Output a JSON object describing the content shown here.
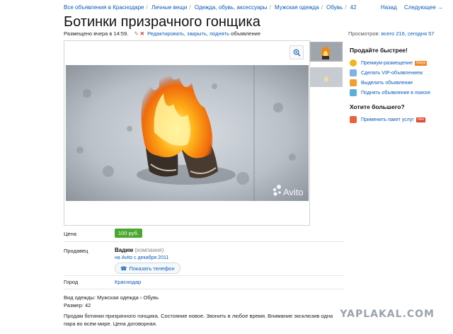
{
  "breadcrumbs": [
    {
      "label": "Все объявления в Краснодаре"
    },
    {
      "label": "Личные вещи"
    },
    {
      "label": "Одежда, обувь, аксессуары"
    },
    {
      "label": "Мужская одежда"
    },
    {
      "label": "Обувь"
    },
    {
      "label": "42"
    }
  ],
  "topnav": {
    "back": "Назад",
    "next": "Следующее →"
  },
  "title": "Ботинки призрачного гонщика",
  "meta": {
    "posted": "Размещено вчера в 14:59.",
    "edit_links": "Редактировать, закрыть, поднять",
    "tail": "объявление"
  },
  "views": {
    "label": "Просмотров:",
    "value": "всего 216, сегодня 57"
  },
  "photo": {
    "watermark": "Avito"
  },
  "sidebar": {
    "promote_title": "Продайте быстрее!",
    "promote_items": [
      {
        "label": "Премиум-размещение",
        "badge": "бонус",
        "icon": "star-coin-icon",
        "color": "#f2b51a"
      },
      {
        "label": "Сделать VIP-объявлением",
        "badge": "",
        "icon": "vip-icon",
        "color": "#7fb3e6"
      },
      {
        "label": "Выделить объявление",
        "badge": "",
        "icon": "highlight-icon",
        "color": "#f0a030"
      },
      {
        "label": "Поднять объявление в поиске",
        "badge": "",
        "icon": "raise-icon",
        "color": "#5ab0d8"
      }
    ],
    "more_title": "Хотите большего?",
    "more_items": [
      {
        "label": "Применить пакет услуг",
        "badge": "new",
        "icon": "package-icon",
        "color": "#e8643c"
      }
    ]
  },
  "price": {
    "label": "Цена",
    "value": "100 руб."
  },
  "seller": {
    "label": "Продавец",
    "name": "Вадим",
    "role": "(компания)",
    "since": "на Avito с декабря 2011",
    "phone_button": "Показать телефон"
  },
  "city": {
    "label": "Город",
    "value": "Краснодар"
  },
  "params": {
    "type": "Вид одежды: Мужская одежда › Обувь",
    "size": "Размер: 42"
  },
  "description": "Продам ботинки призрачного гонщика. Состояние новое. Звонить в любое время. Внимание эксклюзив одна пара во всем мире. Цена договорная.",
  "watermark": "YAPLAKAL.COM",
  "colors": {
    "link": "#0b5bb7",
    "price": "#4aa72f",
    "badge_orange": "#f0882a",
    "badge_red": "#e2452e"
  }
}
